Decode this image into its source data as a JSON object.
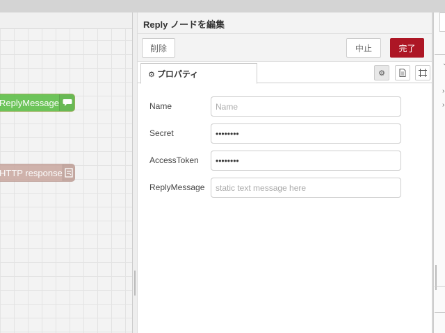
{
  "workspace": {
    "nodes": [
      {
        "label": "ReplyMessage",
        "icon": "speech-bubble-icon"
      },
      {
        "label": "HTTP response",
        "icon": "response-icon"
      }
    ]
  },
  "editor": {
    "title": "Reply ノードを編集",
    "delete_label": "削除",
    "cancel_label": "中止",
    "done_label": "完了",
    "tab_label": "プロパティ",
    "accent_color": "#ad1625"
  },
  "form": {
    "name": {
      "label": "Name",
      "value": "",
      "placeholder": "Name"
    },
    "secret": {
      "label": "Secret",
      "value": "••••••••"
    },
    "access_token": {
      "label": "AccessToken",
      "value": "••••••••"
    },
    "reply_message": {
      "label": "ReplyMessage",
      "value": "",
      "placeholder": "static text message here"
    }
  }
}
